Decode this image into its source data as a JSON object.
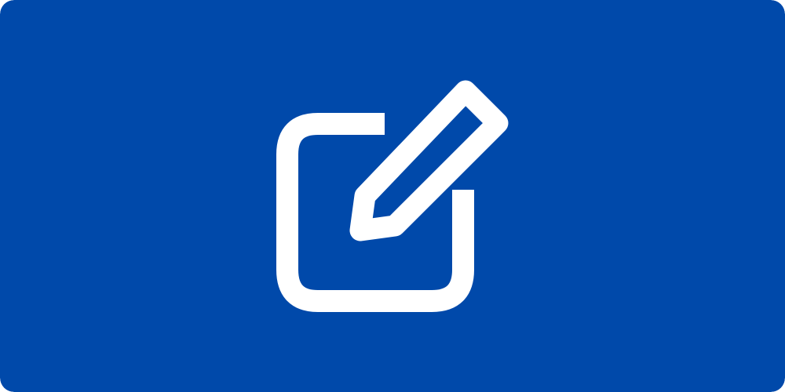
{
  "banner": {
    "background_color": "#0049aa",
    "icon_name": "edit-icon",
    "icon_color": "#ffffff"
  }
}
